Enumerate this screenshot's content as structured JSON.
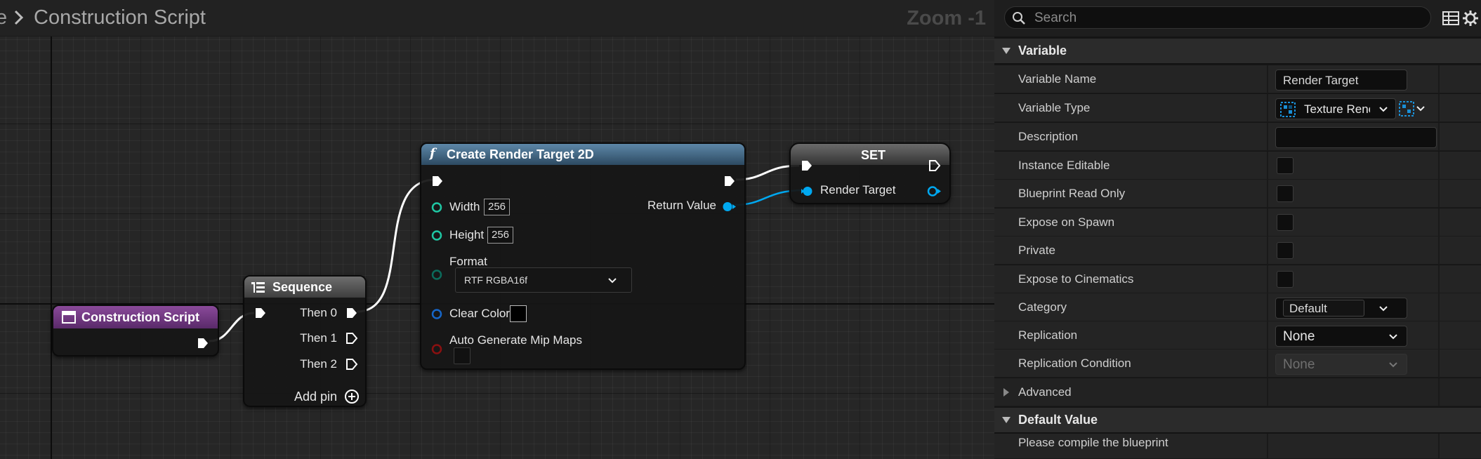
{
  "graph": {
    "breadcrumb_prev": "e",
    "breadcrumb_title": "Construction Script",
    "zoom_label": "Zoom -1"
  },
  "nodes": {
    "construction_script": {
      "title": "Construction Script",
      "color": "#7a3a8a"
    },
    "sequence": {
      "title": "Sequence",
      "outputs": [
        "Then 0",
        "Then 1",
        "Then 2"
      ],
      "add_pin": "Add pin"
    },
    "create_rt": {
      "title": "Create Render Target 2D",
      "width_label": "Width",
      "width_value": "256",
      "height_label": "Height",
      "height_value": "256",
      "format_label": "Format",
      "format_value": "RTF RGBA16f",
      "clear_color_label": "Clear Color",
      "mips_label": "Auto Generate Mip Maps",
      "return_label": "Return Value"
    },
    "set": {
      "title": "SET",
      "var_label": "Render Target"
    }
  },
  "panel": {
    "search_placeholder": "Search",
    "section_variable": "Variable",
    "rows": {
      "variable_name": {
        "label": "Variable Name",
        "value": "Render Target"
      },
      "variable_type": {
        "label": "Variable Type",
        "value": "Texture Renc"
      },
      "description": {
        "label": "Description",
        "value": ""
      },
      "instance_editable": {
        "label": "Instance Editable"
      },
      "blueprint_read_only": {
        "label": "Blueprint Read Only"
      },
      "expose_on_spawn": {
        "label": "Expose on Spawn"
      },
      "private": {
        "label": "Private"
      },
      "expose_cinematics": {
        "label": "Expose to Cinematics"
      },
      "category": {
        "label": "Category",
        "value": "Default"
      },
      "replication": {
        "label": "Replication",
        "value": "None"
      },
      "replication_condition": {
        "label": "Replication Condition",
        "value": "None"
      }
    },
    "section_advanced": "Advanced",
    "section_default_value": "Default Value",
    "compile_note": "Please compile the blueprint"
  },
  "colors": {
    "exec": "#ffffff",
    "int_pin": "#1fc7a3",
    "object_pin": "#00a8f0",
    "format_pin": "#0b6b5b",
    "color_pin": "#1666c8",
    "bool_pin": "#8a1010"
  }
}
